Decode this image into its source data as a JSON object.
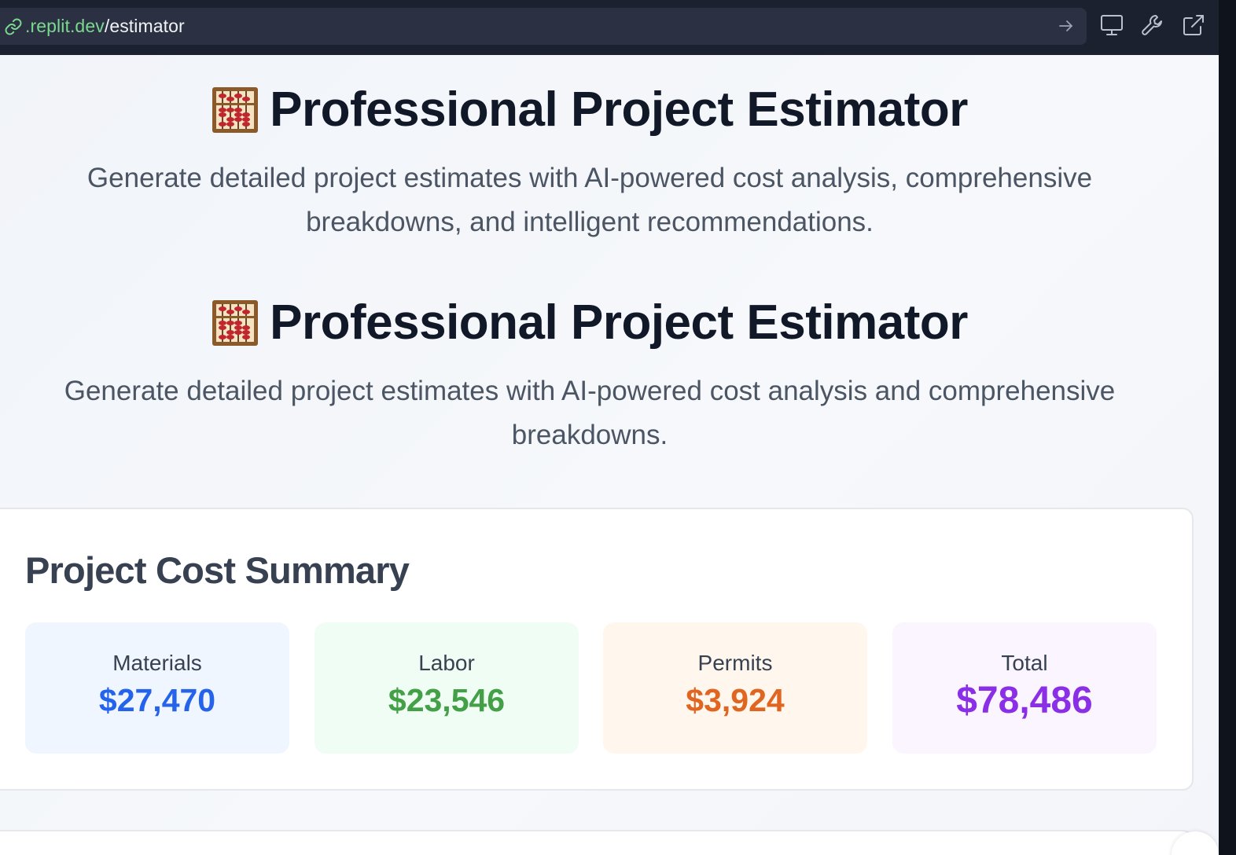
{
  "browser": {
    "url_host": ".replit.dev",
    "url_path": "/estimator",
    "icons": [
      "link-icon",
      "arrow-right-icon",
      "desktop-icon",
      "wrench-icon",
      "external-link-icon"
    ]
  },
  "hero_primary": {
    "emoji": "🧮",
    "title": "Professional Project Estimator",
    "subtitle": "Generate detailed project estimates with AI-powered cost analysis, comprehensive breakdowns, and intelligent recommendations."
  },
  "hero_secondary": {
    "emoji": "🧮",
    "title": "Professional Project Estimator",
    "subtitle": "Generate detailed project estimates with AI-powered cost analysis and comprehensive breakdowns."
  },
  "summary": {
    "title": "Project Cost Summary",
    "tiles": [
      {
        "label": "Materials",
        "value": "$27,470",
        "color": "#2563eb",
        "bg": "#eff6ff"
      },
      {
        "label": "Labor",
        "value": "$23,546",
        "color": "#43a047",
        "bg": "#f0fdf4"
      },
      {
        "label": "Permits",
        "value": "$3,924",
        "color": "#e06520",
        "bg": "#fff7ed"
      },
      {
        "label": "Total",
        "value": "$78,486",
        "color": "#8b2fe6",
        "bg": "#faf5ff"
      }
    ]
  }
}
